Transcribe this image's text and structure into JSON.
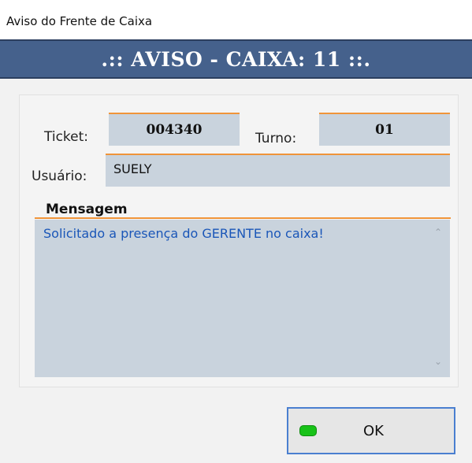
{
  "window": {
    "title": "Aviso do Frente de Caixa"
  },
  "banner": {
    "text": ".:: AVISO - CAIXA: 11 ::."
  },
  "fields": {
    "ticket_label": "Ticket:",
    "ticket_value": "004340",
    "turno_label": "Turno:",
    "turno_value": "01",
    "usuario_label": "Usuário:",
    "usuario_value": "SUELY"
  },
  "message": {
    "group_title": "Mensagem",
    "text": "Solicitado a presença do GERENTE no caixa!"
  },
  "buttons": {
    "ok_label": "OK"
  },
  "colors": {
    "banner_bg": "#45618c",
    "field_bg": "#c9d3dd",
    "field_accent": "#f0943a",
    "message_text": "#1a56b8",
    "ok_indicator": "#18c218",
    "ok_border": "#4a7fd0"
  }
}
